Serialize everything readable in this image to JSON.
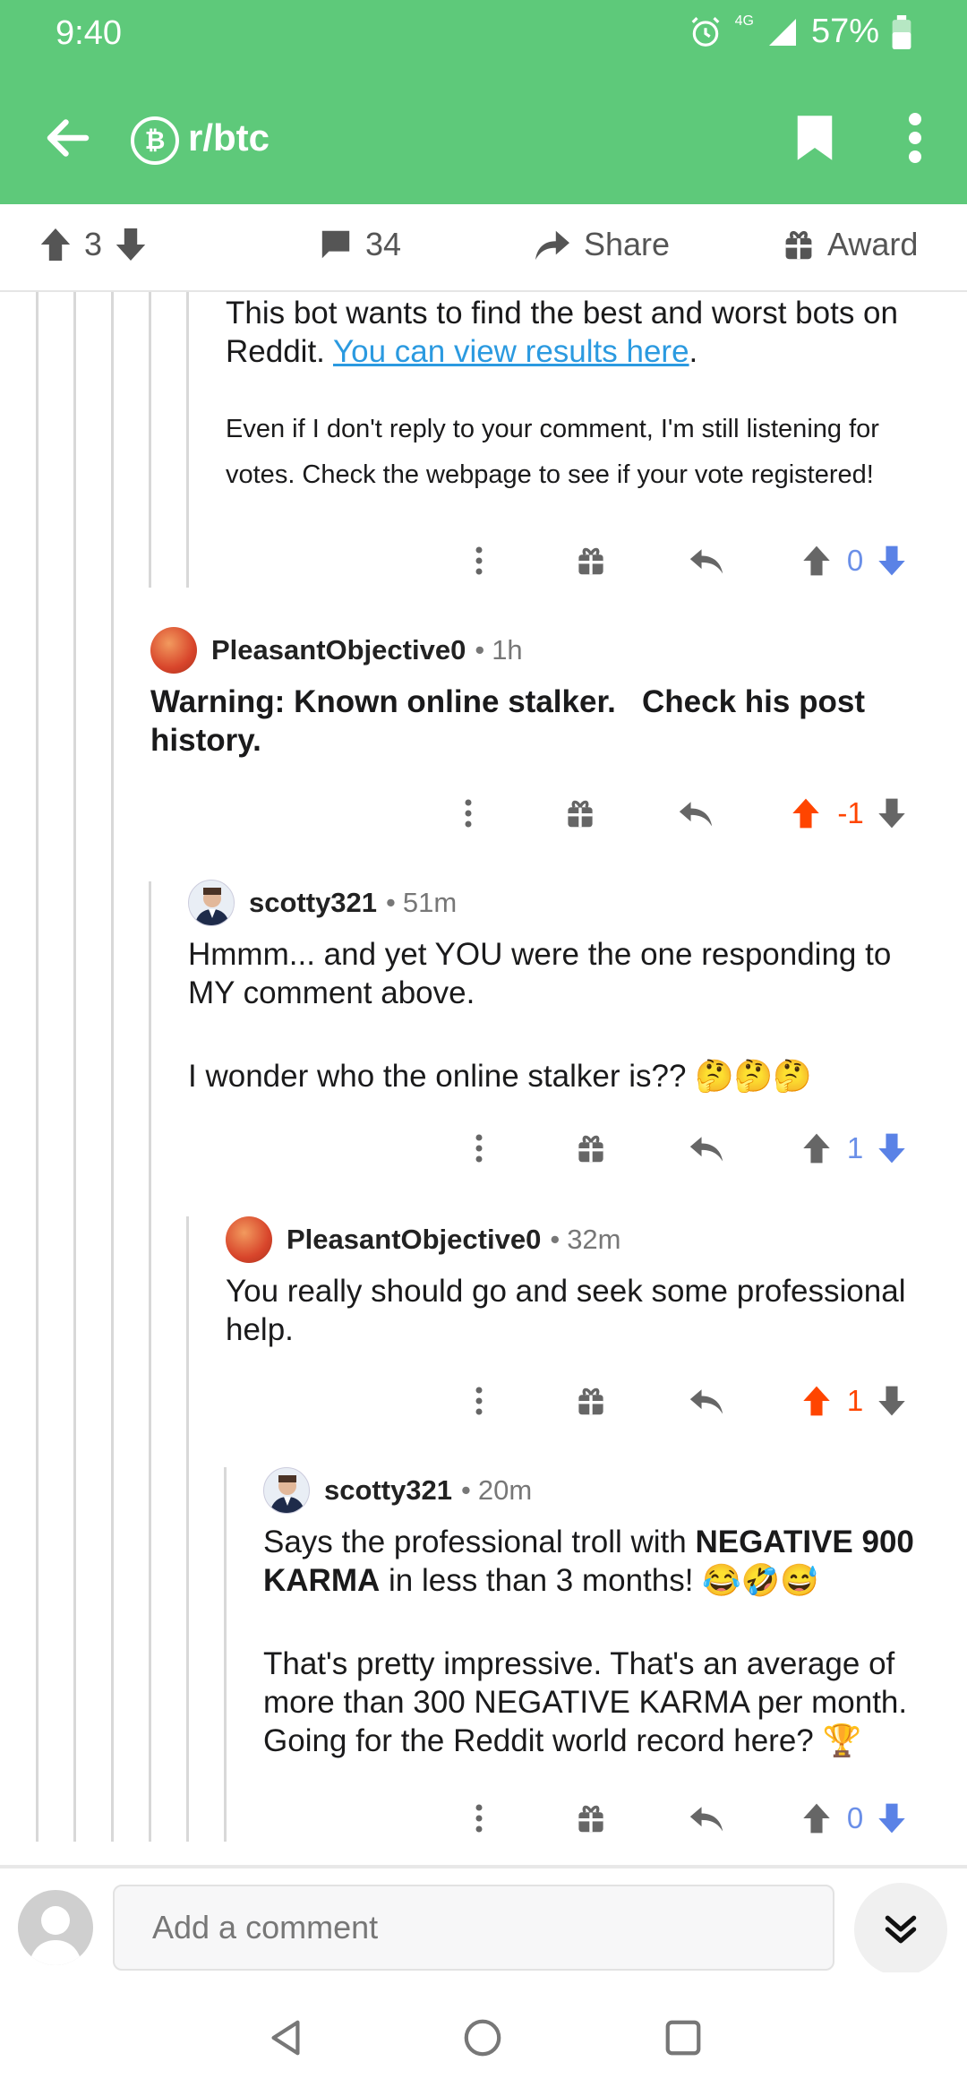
{
  "status_bar": {
    "time": "9:40",
    "network": "4G",
    "battery": "57%"
  },
  "app_bar": {
    "subreddit": "r/btc",
    "sub_icon": "₿"
  },
  "post_actions": {
    "upvotes": "3",
    "comments": "34",
    "share_label": "Share",
    "award_label": "Award"
  },
  "colors": {
    "accent": "#5ec97a",
    "upvoted": "#ff4500",
    "downvoted": "#6a8fe8",
    "link": "#2b9ae0"
  },
  "comments": [
    {
      "body_part1": "This bot wants to find the best and worst bots on Reddit. ",
      "body_link": "You can view results here",
      "body_part2": ".",
      "small_text": "Even if I don't reply to your comment, I'm still listening for votes. Check the webpage to see if your vote registered!",
      "score": "0"
    },
    {
      "author": "PleasantObjective0",
      "time": "1h",
      "body": "Warning: Known online stalker.   Check his post history.",
      "score": "-1"
    },
    {
      "author": "scotty321",
      "time": "51m",
      "body_p1": "Hmmm... and yet YOU were the one responding to MY comment above.",
      "body_p2": "I wonder who the online stalker is?? 🤔🤔🤔",
      "score": "1"
    },
    {
      "author": "PleasantObjective0",
      "time": "32m",
      "body": "You really should go and seek some professional help.",
      "score": "1"
    },
    {
      "author": "scotty321",
      "time": "20m",
      "body_p1_a": "Says the professional troll with ",
      "body_p1_bold": "NEGATIVE 900 KARMA",
      "body_p1_b": " in less than 3 months! 😂🤣😅",
      "body_p2": "That's pretty impressive. That's an average of more than 300 NEGATIVE KARMA per month. Going for the Reddit world record here? 🏆",
      "score": "0"
    }
  ],
  "composer": {
    "placeholder": "Add a comment"
  }
}
